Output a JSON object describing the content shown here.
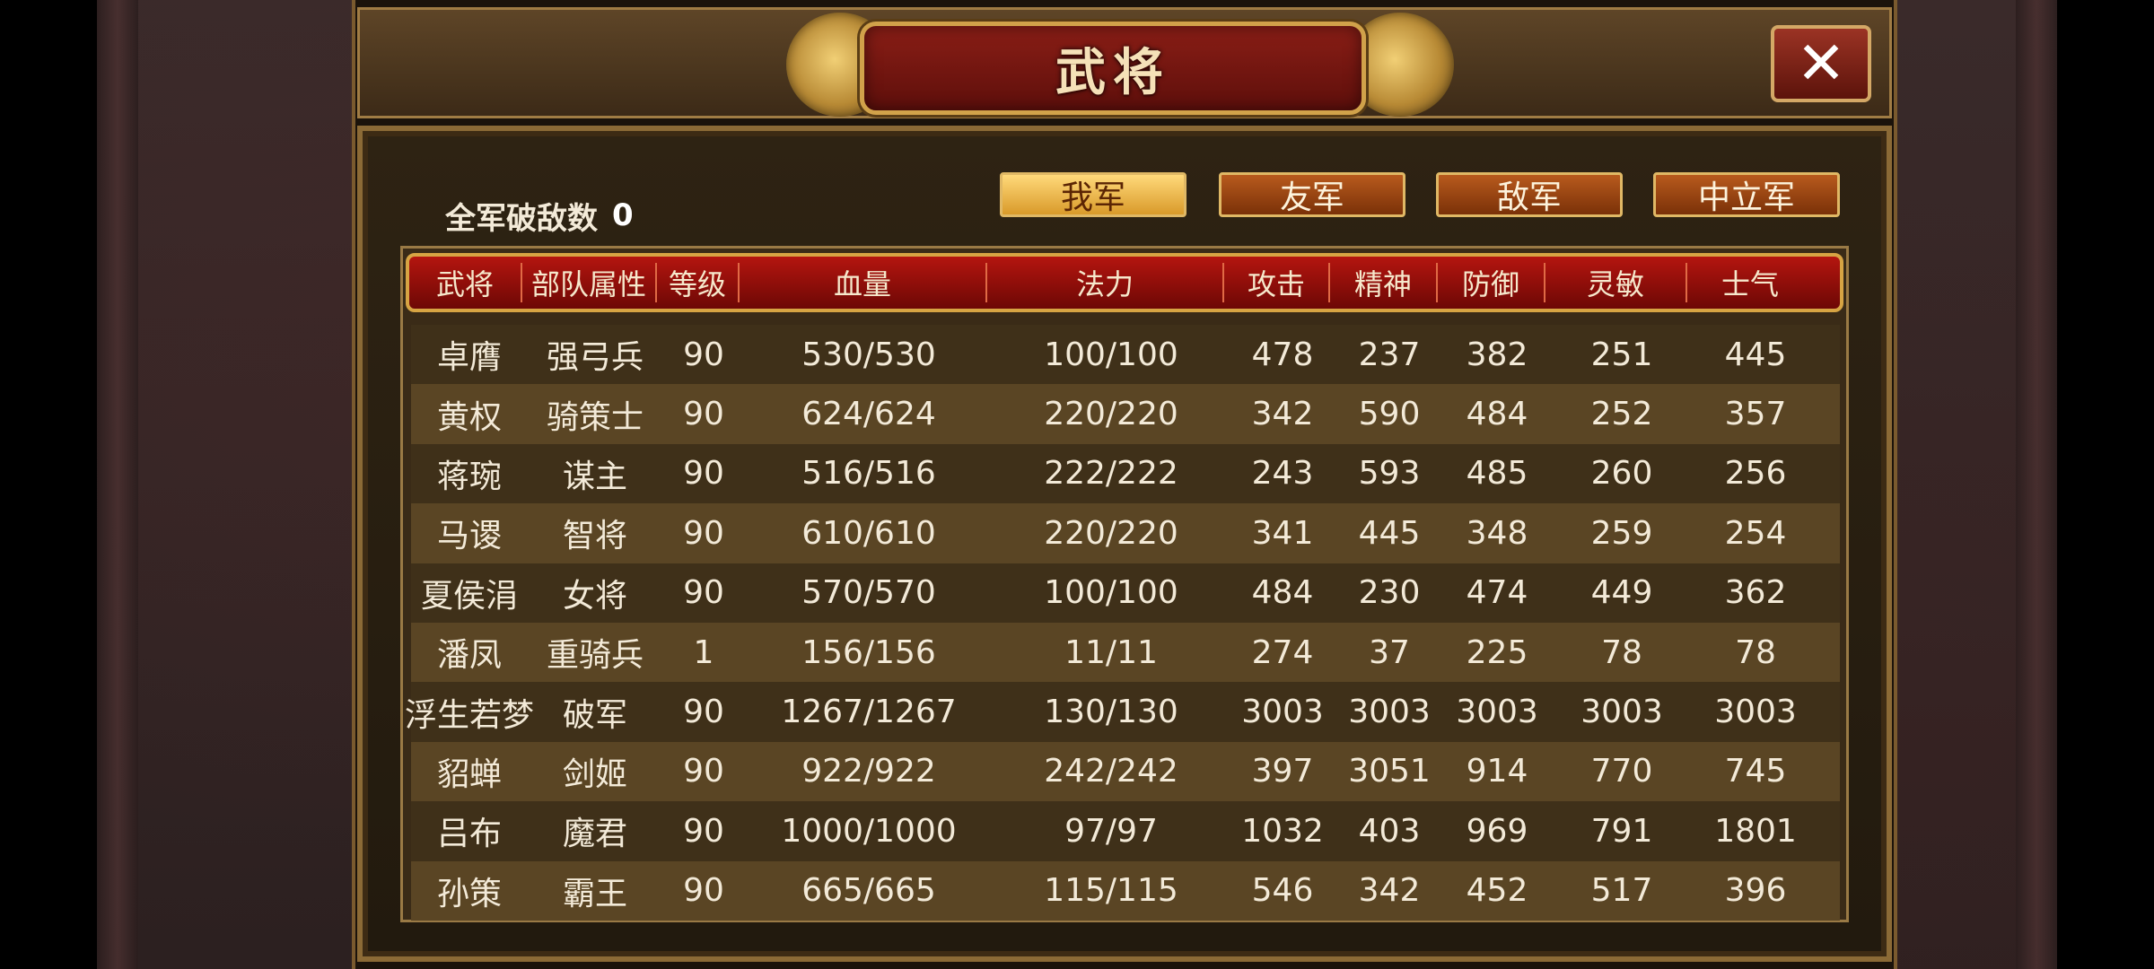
{
  "title": "武将",
  "close_symbol": "✕",
  "kills": {
    "label": "全军破敌数",
    "value": "0"
  },
  "tabs": [
    {
      "label": "我军",
      "active": true
    },
    {
      "label": "友军",
      "active": false
    },
    {
      "label": "敌军",
      "active": false
    },
    {
      "label": "中立军",
      "active": false
    }
  ],
  "table": {
    "headers": [
      "武将",
      "部队属性",
      "等级",
      "血量",
      "法力",
      "攻击",
      "精神",
      "防御",
      "灵敏",
      "士气"
    ],
    "rows": [
      [
        "卓膺",
        "强弓兵",
        "90",
        "530/530",
        "100/100",
        "478",
        "237",
        "382",
        "251",
        "445"
      ],
      [
        "黄权",
        "骑策士",
        "90",
        "624/624",
        "220/220",
        "342",
        "590",
        "484",
        "252",
        "357"
      ],
      [
        "蒋琬",
        "谋主",
        "90",
        "516/516",
        "222/222",
        "243",
        "593",
        "485",
        "260",
        "256"
      ],
      [
        "马谡",
        "智将",
        "90",
        "610/610",
        "220/220",
        "341",
        "445",
        "348",
        "259",
        "254"
      ],
      [
        "夏侯涓",
        "女将",
        "90",
        "570/570",
        "100/100",
        "484",
        "230",
        "474",
        "449",
        "362"
      ],
      [
        "潘凤",
        "重骑兵",
        "1",
        "156/156",
        "11/11",
        "274",
        "37",
        "225",
        "78",
        "78"
      ],
      [
        "浮生若梦",
        "破军",
        "90",
        "1267/1267",
        "130/130",
        "3003",
        "3003",
        "3003",
        "3003",
        "3003"
      ],
      [
        "貂蝉",
        "剑姬",
        "90",
        "922/922",
        "242/242",
        "397",
        "3051",
        "914",
        "770",
        "745"
      ],
      [
        "吕布",
        "魔君",
        "90",
        "1000/1000",
        "97/97",
        "1032",
        "403",
        "969",
        "791",
        "1801"
      ],
      [
        "孙策",
        "霸王",
        "90",
        "665/665",
        "115/115",
        "546",
        "342",
        "452",
        "517",
        "396"
      ]
    ]
  },
  "colors": {
    "accent_gold": "#d7a443",
    "header_red": "#b4150f",
    "text": "#f3ead8"
  }
}
